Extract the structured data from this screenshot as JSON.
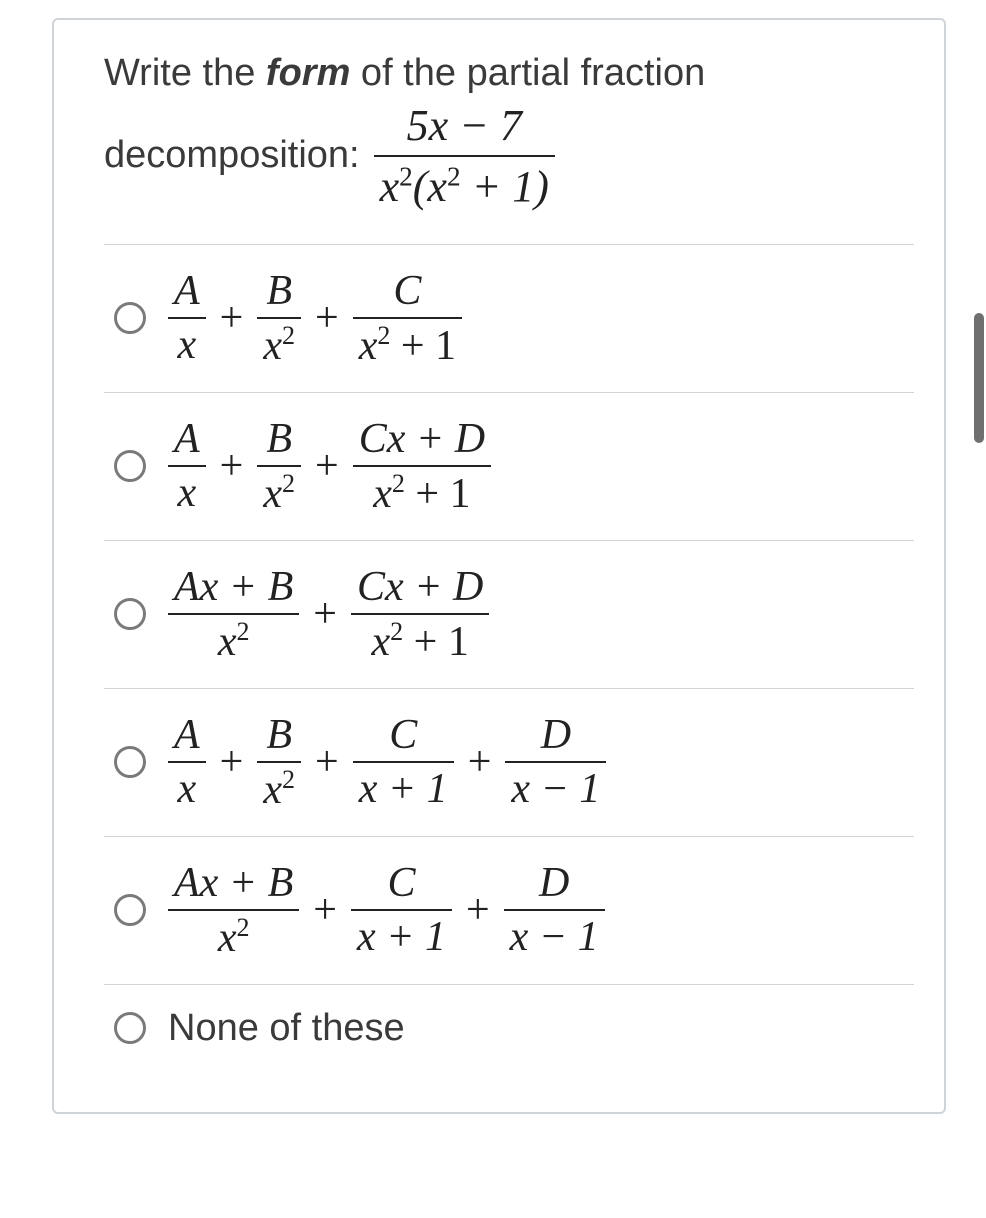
{
  "question": {
    "line1_pre": "Write the ",
    "line1_bold": "form",
    "line1_post": " of the partial fraction",
    "line2_label": "decomposition:",
    "expr": {
      "num": "5x − 7",
      "den_a": "x",
      "den_b": "(x",
      "den_c": " + 1)"
    }
  },
  "opts": {
    "o1": {
      "f1": {
        "n": "A",
        "d": "x"
      },
      "f2": {
        "n": "B",
        "da": "x"
      },
      "f3": {
        "n": "C",
        "da": "x",
        "db": " + 1"
      }
    },
    "o2": {
      "f1": {
        "n": "A",
        "d": "x"
      },
      "f2": {
        "n": "B",
        "da": "x"
      },
      "f3": {
        "n": "Cx + D",
        "da": "x",
        "db": " + 1"
      }
    },
    "o3": {
      "f1": {
        "n": "Ax + B",
        "da": "x"
      },
      "f2": {
        "n": "Cx + D",
        "da": "x",
        "db": " + 1"
      }
    },
    "o4": {
      "f1": {
        "n": "A",
        "d": "x"
      },
      "f2": {
        "n": "B",
        "da": "x"
      },
      "f3": {
        "n": "C",
        "d": "x + 1"
      },
      "f4": {
        "n": "D",
        "d": "x − 1"
      }
    },
    "o5": {
      "f1": {
        "n": "Ax + B",
        "da": "x"
      },
      "f2": {
        "n": "C",
        "d": "x + 1"
      },
      "f3": {
        "n": "D",
        "d": "x − 1"
      }
    },
    "o6": {
      "label": "None of these"
    }
  },
  "sym": {
    "plus": "+",
    "two": "2"
  }
}
